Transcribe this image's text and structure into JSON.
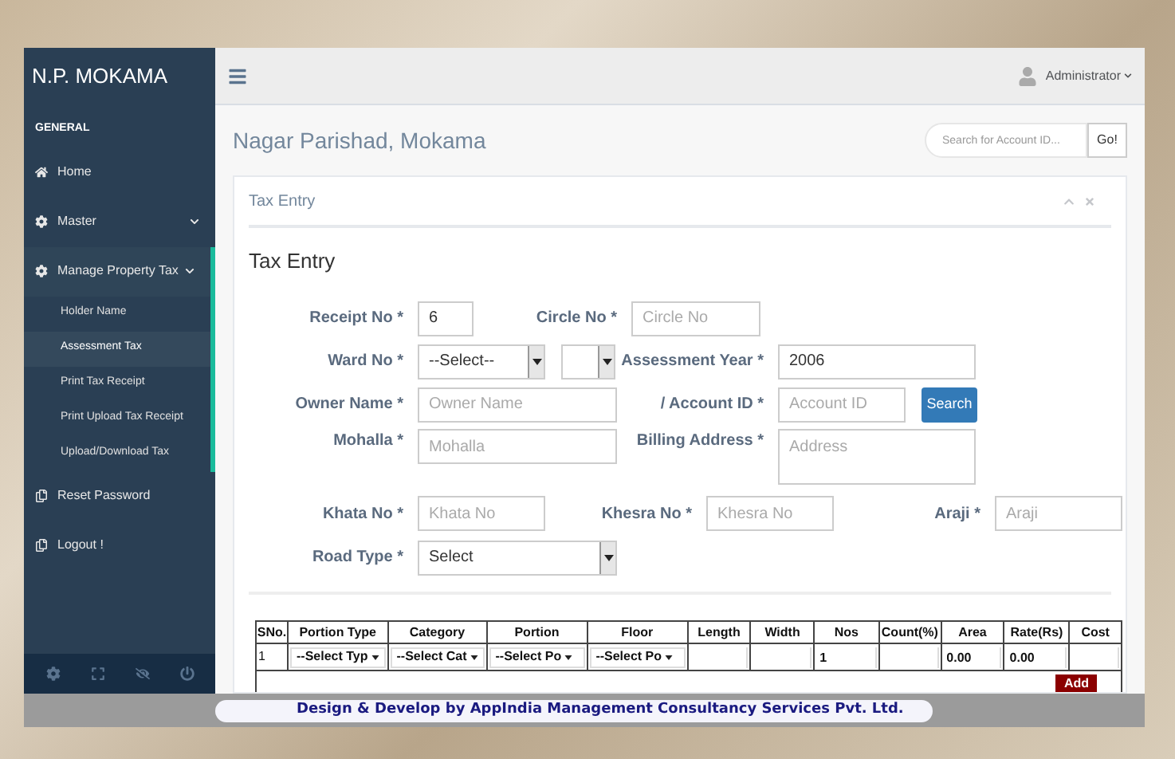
{
  "sidebar": {
    "brand": "N.P. MOKAMA",
    "section": "GENERAL",
    "items": [
      {
        "label": "Home",
        "kind": "link",
        "expanded": false
      },
      {
        "label": "Master",
        "kind": "menu",
        "expanded": false
      },
      {
        "label": "Manage Property Tax",
        "kind": "menu",
        "expanded": true,
        "children": [
          {
            "label": "Holder Name",
            "selected": false
          },
          {
            "label": "Assessment Tax",
            "selected": true
          },
          {
            "label": "Print Tax Receipt",
            "selected": false
          },
          {
            "label": "Print Upload Tax Receipt",
            "selected": false
          },
          {
            "label": "Upload/Download Tax",
            "selected": false
          }
        ]
      },
      {
        "label": "Reset Password",
        "kind": "link",
        "expanded": false
      },
      {
        "label": "Logout !",
        "kind": "link",
        "expanded": false
      }
    ]
  },
  "topbar": {
    "user": "Administrator"
  },
  "page_title": "Nagar Parishad, Mokama",
  "account_search": {
    "placeholder": "Search for Account ID...",
    "button": "Go!"
  },
  "panel": {
    "title": "Tax Entry",
    "heading": "Tax Entry"
  },
  "form": {
    "receipt_no": {
      "label": "Receipt No *",
      "value": "6"
    },
    "circle_no": {
      "label": "Circle No *",
      "placeholder": "Circle No"
    },
    "ward_no": {
      "label": "Ward No *",
      "value": "--Select--"
    },
    "assessment_year": {
      "label": "Assessment Year *",
      "value": "2006"
    },
    "owner_name": {
      "label": "Owner Name *",
      "placeholder": "Owner Name"
    },
    "account_id": {
      "label": "/ Account ID *",
      "placeholder": "Account ID",
      "button": "Search"
    },
    "mohalla": {
      "label": "Mohalla *",
      "placeholder": "Mohalla"
    },
    "billing_address": {
      "label": "Billing Address *",
      "placeholder": "Address"
    },
    "khata_no": {
      "label": "Khata No *",
      "placeholder": "Khata No"
    },
    "khesra_no": {
      "label": "Khesra No *",
      "placeholder": "Khesra No"
    },
    "araji": {
      "label": "Araji *",
      "placeholder": "Araji"
    },
    "road_type": {
      "label": "Road Type *",
      "value": "Select"
    }
  },
  "table": {
    "columns": [
      "SNo.",
      "Portion Type",
      "Category",
      "Portion",
      "Floor",
      "Length",
      "Width",
      "Nos",
      "Count(%)",
      "Area",
      "Rate(Rs)",
      "Cost"
    ],
    "rows": [
      [
        {
          "kind": "text",
          "value": "1"
        },
        {
          "kind": "select",
          "value": "--Select Typ"
        },
        {
          "kind": "select",
          "value": "--Select Cat"
        },
        {
          "kind": "select",
          "value": "--Select Po"
        },
        {
          "kind": "select",
          "value": "--Select Po"
        },
        {
          "kind": "input"
        },
        {
          "kind": "input"
        },
        {
          "kind": "input",
          "value": "1"
        },
        {
          "kind": "input"
        },
        {
          "kind": "input",
          "value": "0.00"
        },
        {
          "kind": "input",
          "value": "0.00"
        },
        {
          "kind": "input"
        }
      ]
    ],
    "add_button": "Add"
  },
  "footer": "Design & Develop by AppIndia Management Consultancy Services Pvt. Ltd."
}
